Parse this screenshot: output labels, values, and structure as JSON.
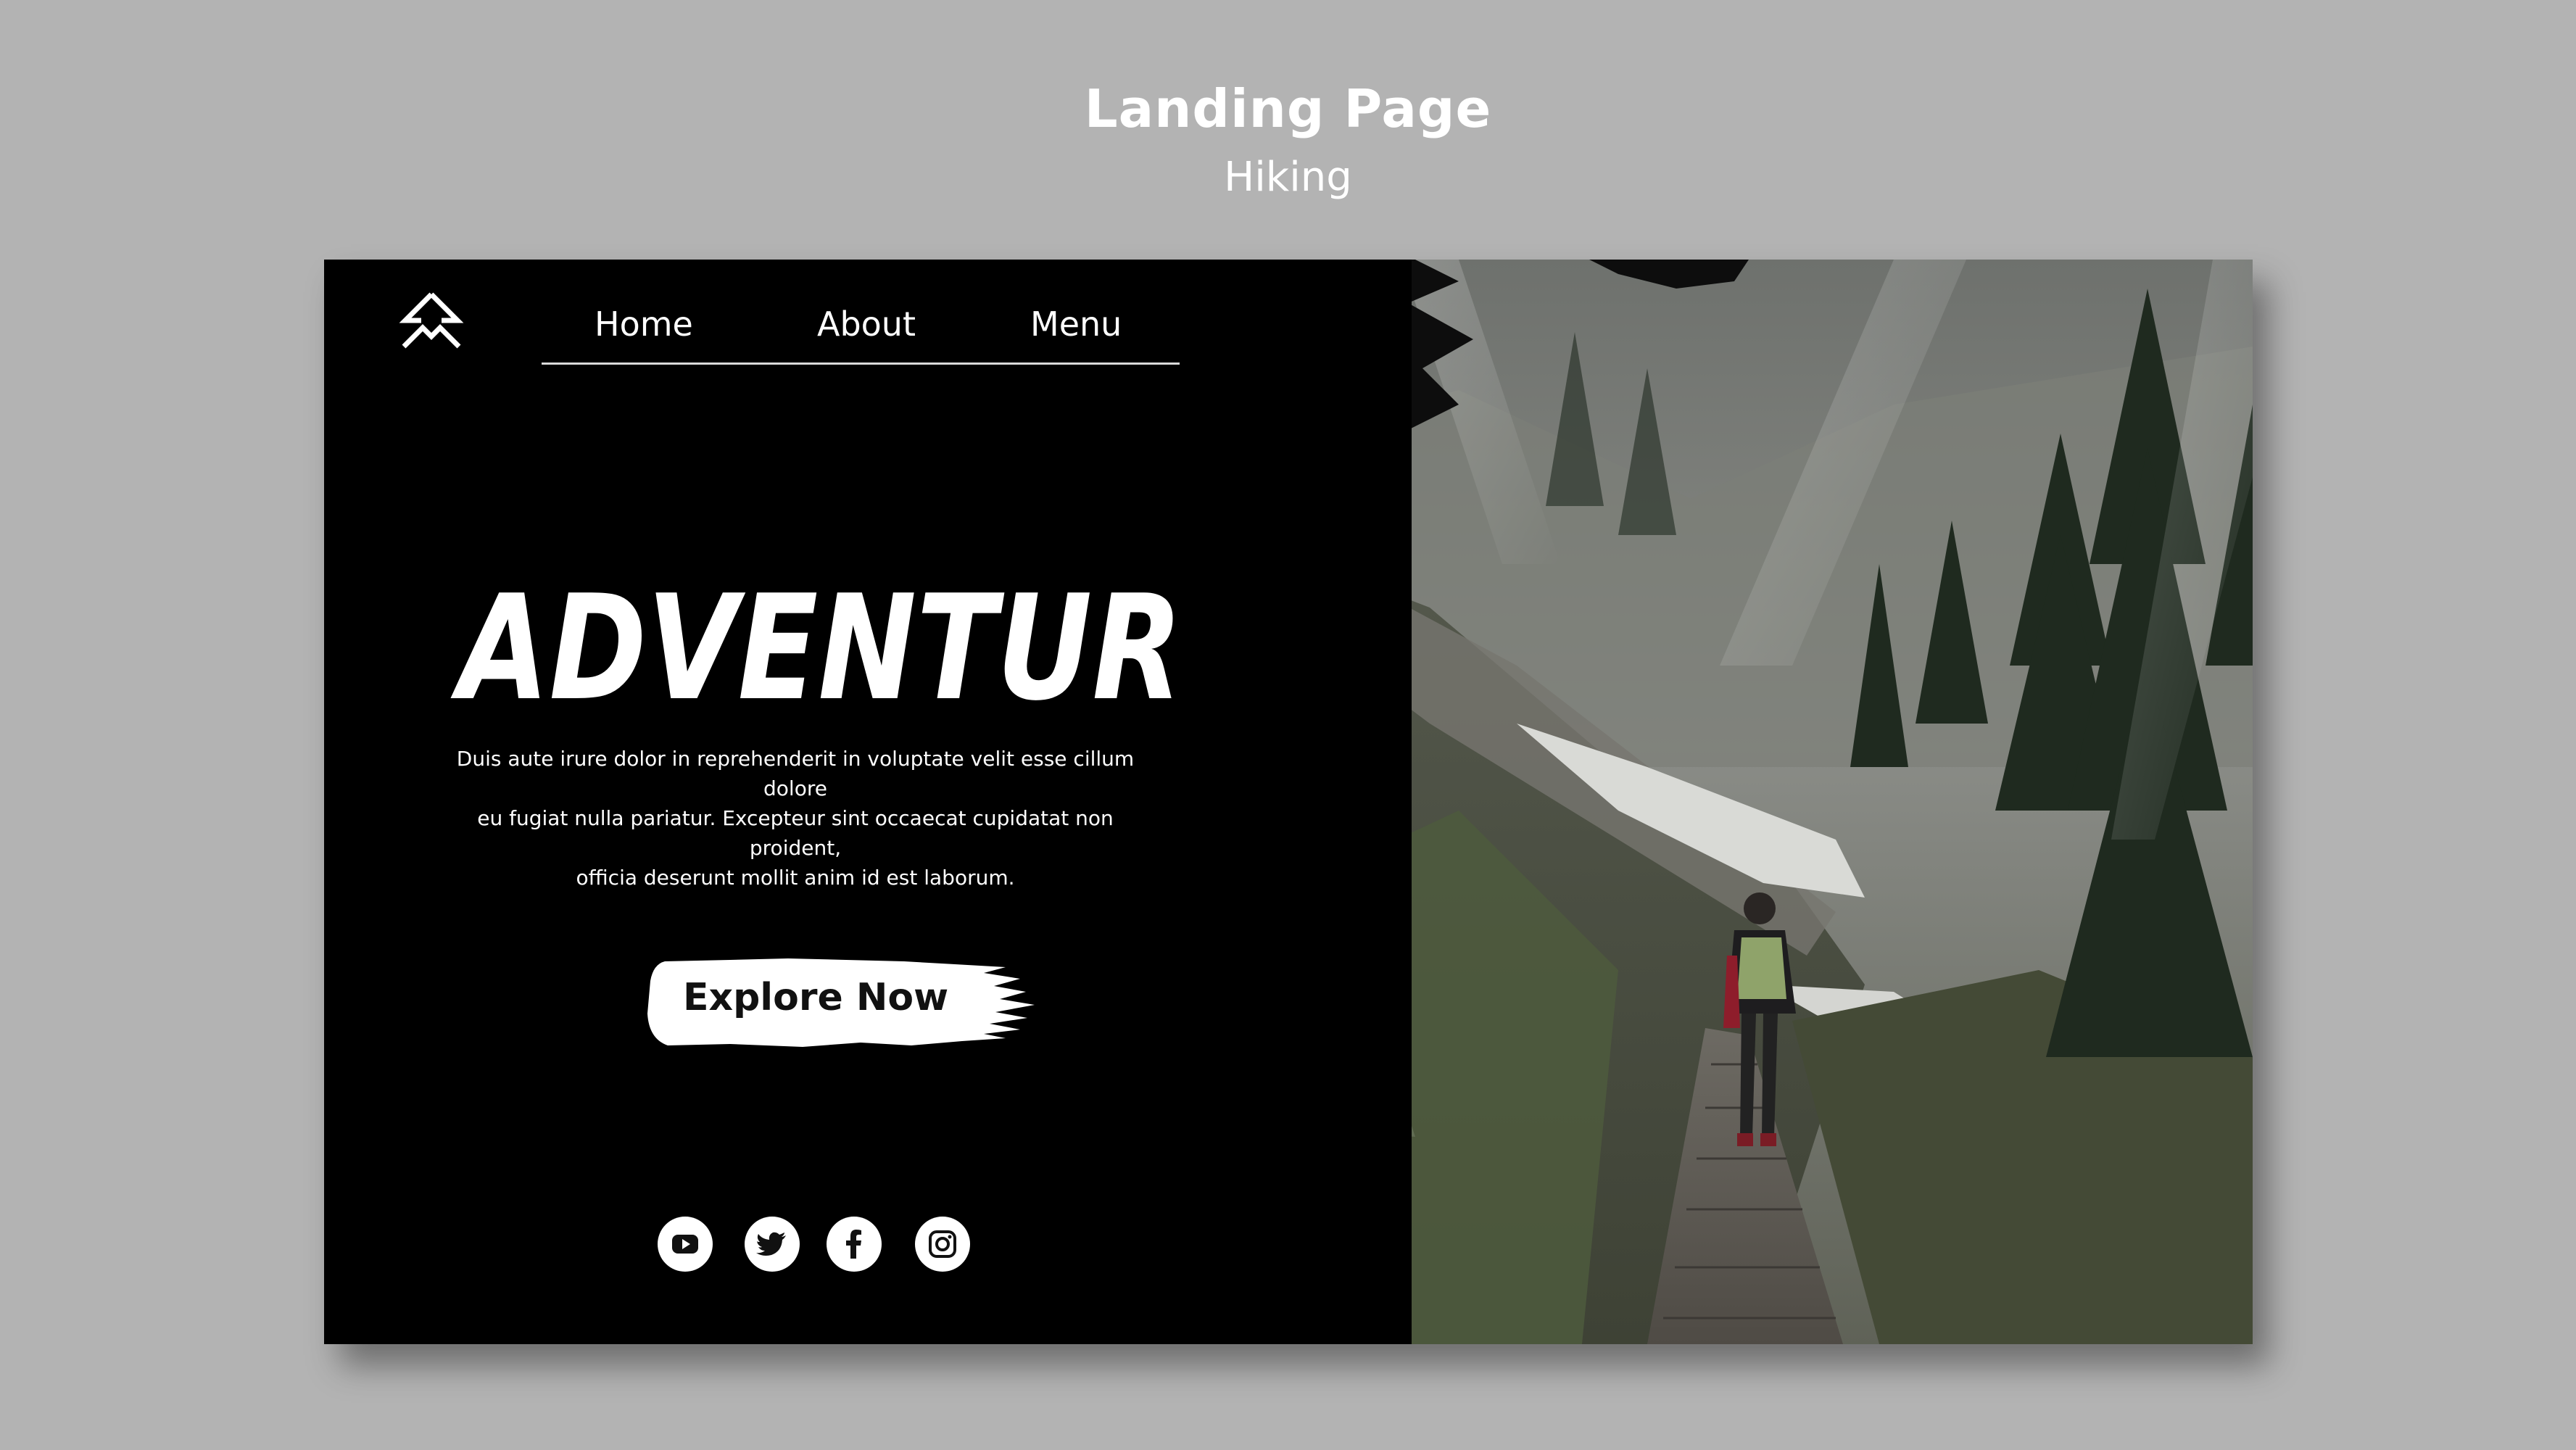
{
  "header": {
    "title": "Landing Page",
    "subtitle": "Hiking"
  },
  "nav": {
    "items": [
      {
        "label": "Home"
      },
      {
        "label": "About"
      },
      {
        "label": "Menu"
      }
    ]
  },
  "hero": {
    "headline": "ADVENTURE",
    "description_lines": [
      "Duis aute irure dolor in reprehenderit in voluptate velit esse cillum dolore",
      "eu fugiat nulla pariatur. Excepteur sint occaecat cupidatat non proident,",
      "officia deserunt mollit anim id est laborum."
    ],
    "cta_label": "Explore Now"
  },
  "socials": [
    {
      "name": "youtube-icon"
    },
    {
      "name": "twitter-icon"
    },
    {
      "name": "facebook-icon"
    },
    {
      "name": "instagram-icon"
    }
  ],
  "colors": {
    "page_background": "#b3b3b3",
    "panel_background": "#000000",
    "text": "#ffffff",
    "cta_text": "#111111"
  }
}
